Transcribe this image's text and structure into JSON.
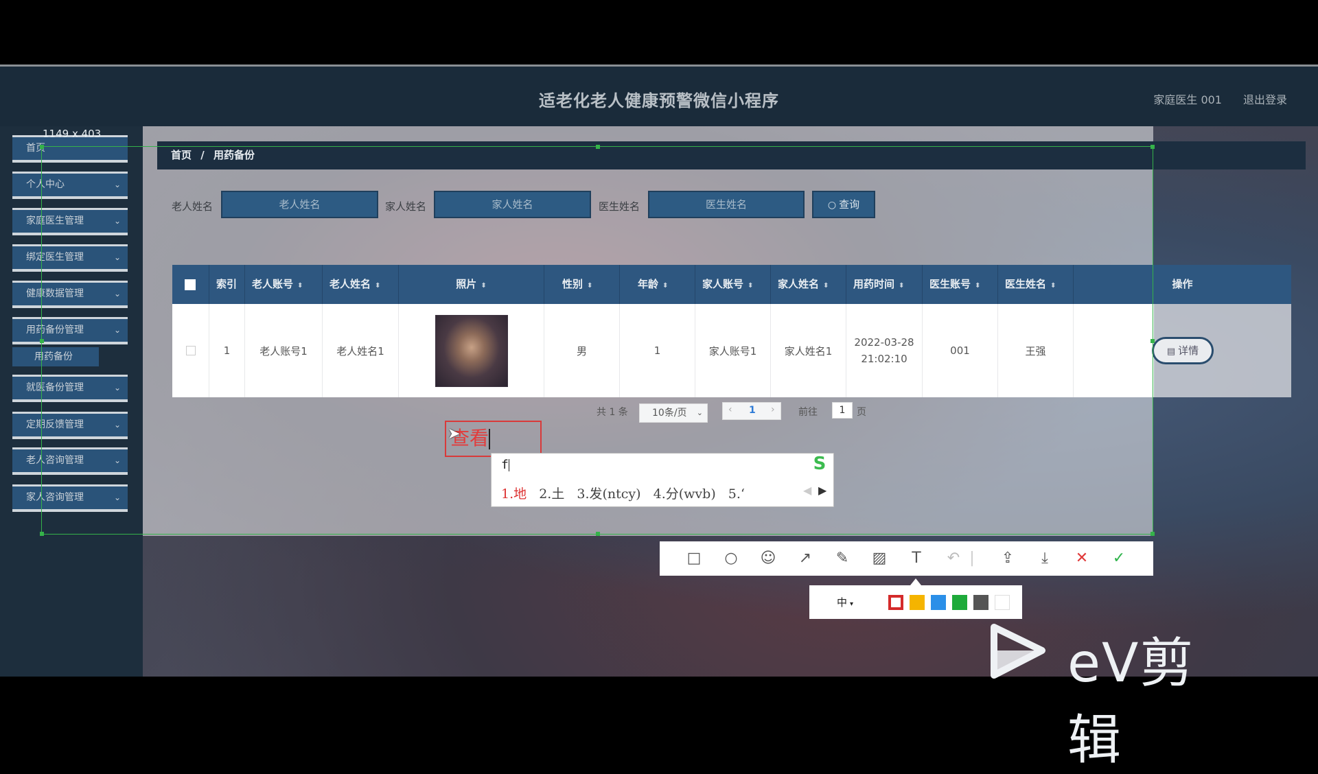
{
  "app": {
    "title": "适老化老人健康预警微信小程序",
    "user": "家庭医生 001",
    "logout": "退出登录"
  },
  "sidebar": {
    "items": [
      {
        "label": "首页",
        "chevron": ""
      },
      {
        "label": "个人中心",
        "chevron": "⌄"
      },
      {
        "label": "家庭医生管理",
        "chevron": "⌄"
      },
      {
        "label": "绑定医生管理",
        "chevron": "⌄"
      },
      {
        "label": "健康数据管理",
        "chevron": "⌄"
      },
      {
        "label": "用药备份管理",
        "chevron": "⌄"
      },
      {
        "label": "就医备份管理",
        "chevron": "⌄"
      },
      {
        "label": "定期反馈管理",
        "chevron": "⌄"
      },
      {
        "label": "老人咨询管理",
        "chevron": "⌄"
      },
      {
        "label": "家人咨询管理",
        "chevron": "⌄"
      }
    ],
    "sub_item": "用药备份"
  },
  "breadcrumb": {
    "home": "首页",
    "sep": "/",
    "current": "用药备份"
  },
  "search": {
    "elder_label": "老人姓名",
    "elder_placeholder": "老人姓名",
    "family_label": "家人姓名",
    "family_placeholder": "家人姓名",
    "doctor_label": "医生姓名",
    "doctor_placeholder": "医生姓名",
    "button": "查询",
    "button_icon": "search-icon"
  },
  "table": {
    "headers": [
      "索引",
      "老人账号",
      "老人姓名",
      "照片",
      "性别",
      "年龄",
      "家人账号",
      "家人姓名",
      "用药时间",
      "医生账号",
      "医生姓名",
      "操作"
    ],
    "sort_icon": "⬍",
    "row": {
      "index": "1",
      "elder_account": "老人账号1",
      "elder_name": "老人姓名1",
      "gender": "男",
      "age": "1",
      "family_account": "家人账号1",
      "family_name": "家人姓名1",
      "time_date": "2022-03-28",
      "time_clock": "21:02:10",
      "doctor_account": "001",
      "doctor_name": "王强"
    },
    "detail_button": "详情"
  },
  "pagination": {
    "total": "共 1 条",
    "page_size": "10条/页",
    "current_page": "1",
    "goto_label": "前往",
    "goto_value": "1",
    "page_unit": "页"
  },
  "screenshot_tool": {
    "size_label": "1149 x 403",
    "annotation_text": "查看",
    "ime_input": "f",
    "ime_candidates": [
      "1.地",
      "2.土",
      "3.发(ntcy)",
      "4.分(wvb)",
      "5.‘"
    ],
    "ime_logo": "S",
    "tools": [
      "rectangle-icon",
      "ellipse-icon",
      "emoji-icon",
      "arrow-icon",
      "pen-icon",
      "mosaic-icon",
      "text-icon",
      "undo-icon",
      "share-icon",
      "download-icon",
      "close-icon",
      "confirm-icon"
    ],
    "pen_size": "中",
    "colors": [
      "#d42a2a",
      "#f5b400",
      "#2b8fe8",
      "#1eaa3a",
      "#555555",
      "#ffffff"
    ]
  },
  "watermark": {
    "text": "eV剪辑"
  }
}
